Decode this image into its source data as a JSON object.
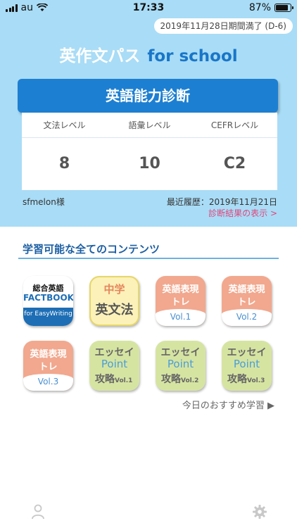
{
  "status_bar": {
    "carrier": "au",
    "time": "17:33",
    "battery": "87%",
    "battery_level": 0.87
  },
  "header": {
    "expiry": "2019年11月28日期間満了 (D-6)",
    "app_title": "英作文パス",
    "app_subtitle": "for school"
  },
  "diagnosis": {
    "button_label": "英語能力診断",
    "columns": [
      {
        "label": "文法レベル",
        "value": "8"
      },
      {
        "label": "語彙レベル",
        "value": "10"
      },
      {
        "label": "CEFRレベル",
        "value": "C2"
      }
    ]
  },
  "user": {
    "name": "sfmelon様",
    "history": "最近履歴：2019年11月21日",
    "result_link": "診断結果の表示 >"
  },
  "contents": {
    "section_title": "学習可能な全てのコンテンツ",
    "tiles": [
      {
        "line1": "総合英語",
        "line2": "FACTBOOK",
        "line3": "for EasyWriting"
      },
      {
        "line1": "中学",
        "line2": "英文法"
      },
      {
        "line1": "英語表現",
        "line2": "トレ",
        "vol": "Vol.1"
      },
      {
        "line1": "英語表現",
        "line2": "トレ",
        "vol": "Vol.2"
      },
      {
        "line1": "英語表現",
        "line2": "トレ",
        "vol": "Vol.3"
      },
      {
        "line1": "エッセイ",
        "line2": "Point",
        "line3": "攻略",
        "vol": "Vol.1"
      },
      {
        "line1": "エッセイ",
        "line2": "Point",
        "line3": "攻略",
        "vol": "Vol.2"
      },
      {
        "line1": "エッセイ",
        "line2": "Point",
        "line3": "攻略",
        "vol": "Vol.3"
      }
    ],
    "today_link": "今日のおすすめ学習 ▶"
  },
  "tabbar": {
    "left_icon": "person-icon",
    "right_icon": "gear-icon"
  },
  "colors": {
    "top_bg": "#a9dcf6",
    "accent_blue": "#1d7fd1",
    "link_pink": "#e0467c"
  }
}
